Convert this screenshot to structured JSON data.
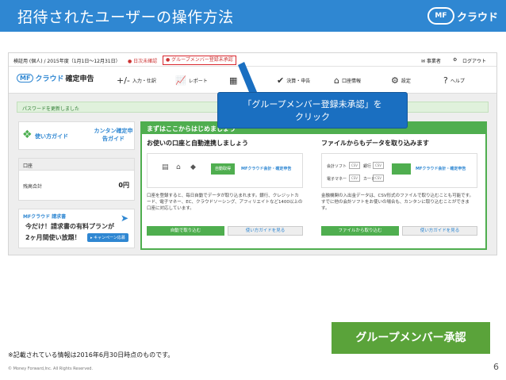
{
  "slide": {
    "title": "招待されたユーザーの操作方法",
    "brand_mark": "MF",
    "brand_text": "クラウド",
    "page_number": "6",
    "note": "※記載されている情報は2016年6月30日時点のものです。",
    "copyright": "© Money Forward,Inc. All Rights Reserved.",
    "action_button": "グループメンバー承認",
    "callout": [
      "「グループメンバー登録未承認」を",
      "クリック"
    ]
  },
  "app": {
    "topbar": {
      "year": "検証用 (個人) / 2015年度（1月1日〜12月31日）",
      "unconfirmed": "日次未確認",
      "group_pending": "グループメンバー登録未承認",
      "help": "✉ 事業者",
      "settings": "⚙",
      "logout": "ログアウト"
    },
    "logo": {
      "mark": "MF",
      "name": "クラウド",
      "product": "確定申告"
    },
    "nav": [
      {
        "icon": "+/-",
        "label": "入力・仕訳"
      },
      {
        "icon": "📈",
        "label": "レポート"
      },
      {
        "icon": "▦",
        "label": ""
      },
      {
        "icon": "✔",
        "label": "決算・申告"
      },
      {
        "icon": "⌂",
        "label": "口座情報"
      },
      {
        "icon": "⚙",
        "label": "設定"
      },
      {
        "icon": "?",
        "label": "ヘルプ"
      }
    ],
    "notice": "パスワードを更新しました",
    "guide": {
      "label_a": "使い方ガイド",
      "label_b": "カンタン確定申告ガイド"
    },
    "accounts": {
      "header": "口座",
      "label": "残高合計",
      "value": "0円"
    },
    "ad": {
      "logo": "MFクラウド 請求書",
      "line1": "今だけ！請求書の有料プランが",
      "line2": "2ヶ月間使い放題！",
      "button": "▸ キャンペーン応募"
    },
    "getting_started": {
      "header": "まずはここからはじめましょう",
      "left": {
        "title": "お使いの口座と自動連携しましょう",
        "arrow": "自動取得",
        "dest": "MFクラウド会計・確定申告",
        "desc": "口座を登録すると、毎日自動でデータが取り込まれます。銀行、クレジットカード、電子マネー、EC、クラウドソーシング、アフィリエイトなど1400以上の口座に対応しています。",
        "button_primary": "自動で取り込む",
        "button_secondary": "使い方ガイドを見る"
      },
      "right": {
        "title": "ファイルからもデータを取り込みます",
        "rows": [
          "会計ソフト",
          "銀行",
          "電子マネー",
          "カード"
        ],
        "file_tag": "CSV",
        "dest": "MFクラウド会計・確定申告",
        "desc": "金融機関の入出金データは、CSV形式のファイルで取り込むことも可能です。すでに他の会計ソフトをお使いの場合も、カンタンに取り込むことができます。",
        "button_primary": "ファイルから取り込む",
        "button_secondary": "使い方ガイドを見る"
      }
    }
  }
}
